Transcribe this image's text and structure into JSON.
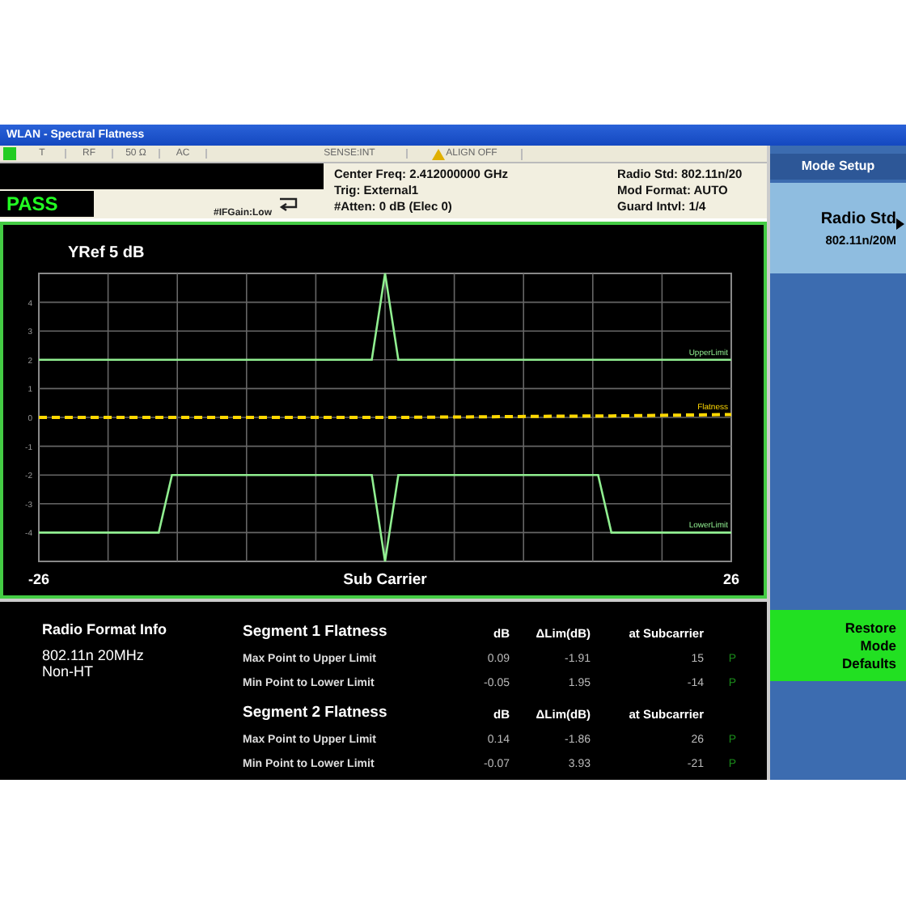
{
  "window": {
    "title": "WLAN - Spectral Flatness"
  },
  "status_bar": {
    "cells": [
      {
        "text": "T",
        "kind": "plain"
      },
      {
        "text": "RF",
        "kind": "plain"
      },
      {
        "text": "50 Ω",
        "kind": "plain"
      },
      {
        "text": "AC",
        "kind": "plain"
      },
      {
        "text": "SENSE:INT",
        "kind": "plain"
      },
      {
        "text": "ALIGN OFF",
        "kind": "warning"
      }
    ]
  },
  "indicator": {
    "result": "PASS",
    "if_gain": "#IFGain:Low"
  },
  "settings_left": [
    "Center Freq: 2.412000000 GHz",
    "Trig: External1",
    "#Atten: 0 dB (Elec 0)"
  ],
  "settings_right": [
    "Radio Std: 802.11n/20",
    "Mod Format: AUTO",
    "Guard Intvl: 1/4"
  ],
  "chart": {
    "chart_data": {
      "type": "line",
      "title": "YRef  5 dB",
      "xlabel": "Sub Carrier",
      "x": [
        -26,
        -17,
        -16,
        -1,
        0,
        1,
        16,
        17,
        26
      ],
      "series": [
        {
          "name": "UpperLimit",
          "color": "#90ee90",
          "values": [
            2,
            2,
            2,
            2,
            5,
            2,
            2,
            2,
            2
          ]
        },
        {
          "name": "Flatness",
          "color": "#ffd800",
          "line_style": "dashed",
          "values": [
            0,
            0,
            0,
            0,
            0,
            0,
            0.05,
            0.05,
            0.1
          ]
        },
        {
          "name": "LowerLimit",
          "color": "#90ee90",
          "values": [
            -4,
            -4,
            -2,
            -2,
            -5,
            -2,
            -2,
            -4,
            -4
          ]
        }
      ],
      "xlim": [
        -26,
        26
      ],
      "ylim": [
        -5,
        5
      ],
      "xticks": [
        -26,
        26
      ],
      "yticks": [
        -4,
        -3,
        -2,
        -1,
        0,
        1,
        2,
        3,
        4
      ],
      "grid": true
    }
  },
  "radio_format": {
    "title": "Radio Format Info",
    "lines": [
      "802.11n 20MHz",
      "Non-HT"
    ]
  },
  "segments": [
    {
      "title": "Segment 1 Flatness",
      "columns": [
        "dB",
        "ΔLim(dB)",
        "at Subcarrier"
      ],
      "rows": [
        {
          "label": "Max Point to Upper Limit",
          "db": "0.09",
          "dlim": "-1.91",
          "subcarrier": "15",
          "result": "P"
        },
        {
          "label": "Min Point to Lower Limit",
          "db": "-0.05",
          "dlim": "1.95",
          "subcarrier": "-14",
          "result": "P"
        }
      ]
    },
    {
      "title": "Segment 2 Flatness",
      "columns": [
        "dB",
        "ΔLim(dB)",
        "at Subcarrier"
      ],
      "rows": [
        {
          "label": "Max Point to Upper Limit",
          "db": "0.14",
          "dlim": "-1.86",
          "subcarrier": "26",
          "result": "P"
        },
        {
          "label": "Min Point to Lower Limit",
          "db": "-0.07",
          "dlim": "3.93",
          "subcarrier": "-21",
          "result": "P"
        }
      ]
    }
  ],
  "softkeys": {
    "title": "Mode Setup",
    "keys": [
      {
        "kind": "submenu",
        "label": "Radio Std",
        "value": "802.11n/20M"
      },
      {
        "kind": "action",
        "label": "Restore Mode Defaults"
      }
    ]
  }
}
